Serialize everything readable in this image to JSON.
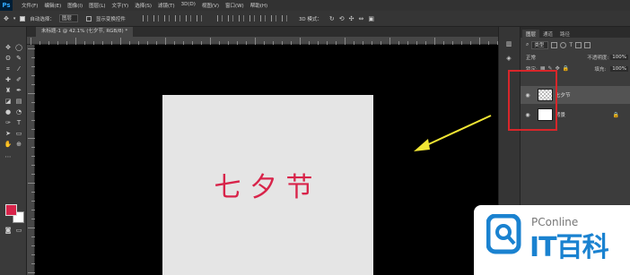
{
  "app": {
    "logo": "Ps"
  },
  "menu": {
    "items": [
      "文件(F)",
      "编辑(E)",
      "图像(I)",
      "图层(L)",
      "文字(Y)",
      "选择(S)",
      "滤镜(T)",
      "3D(D)",
      "视图(V)",
      "窗口(W)",
      "帮助(H)"
    ]
  },
  "options_bar": {
    "auto_select_label": "自动选择：",
    "auto_select_value": "图层",
    "show_transform_label": "显示变换控件",
    "mode_3d_label": "3D 模式："
  },
  "document": {
    "tab_title": "未标题-1 @ 42.1% (七夕节, RGB/8) *",
    "artwork_text": "七夕节"
  },
  "colors": {
    "foreground": "#d8244a",
    "background": "#ffffff",
    "highlight": "#d8262a",
    "arrow": "#f2e634"
  },
  "layers_panel": {
    "tabs": [
      "图层",
      "通道",
      "路径"
    ],
    "filter_kind": "类型",
    "blend_mode": "正常",
    "opacity_label": "不透明度:",
    "opacity_value": "100%",
    "lock_label": "锁定:",
    "fill_label": "填充:",
    "fill_value": "100%",
    "layers": [
      {
        "name": "七夕节",
        "selected": true
      },
      {
        "name": "背景",
        "selected": false,
        "locked": true
      }
    ]
  },
  "watermark": {
    "line1": "PConline",
    "line2": "IT百科"
  }
}
